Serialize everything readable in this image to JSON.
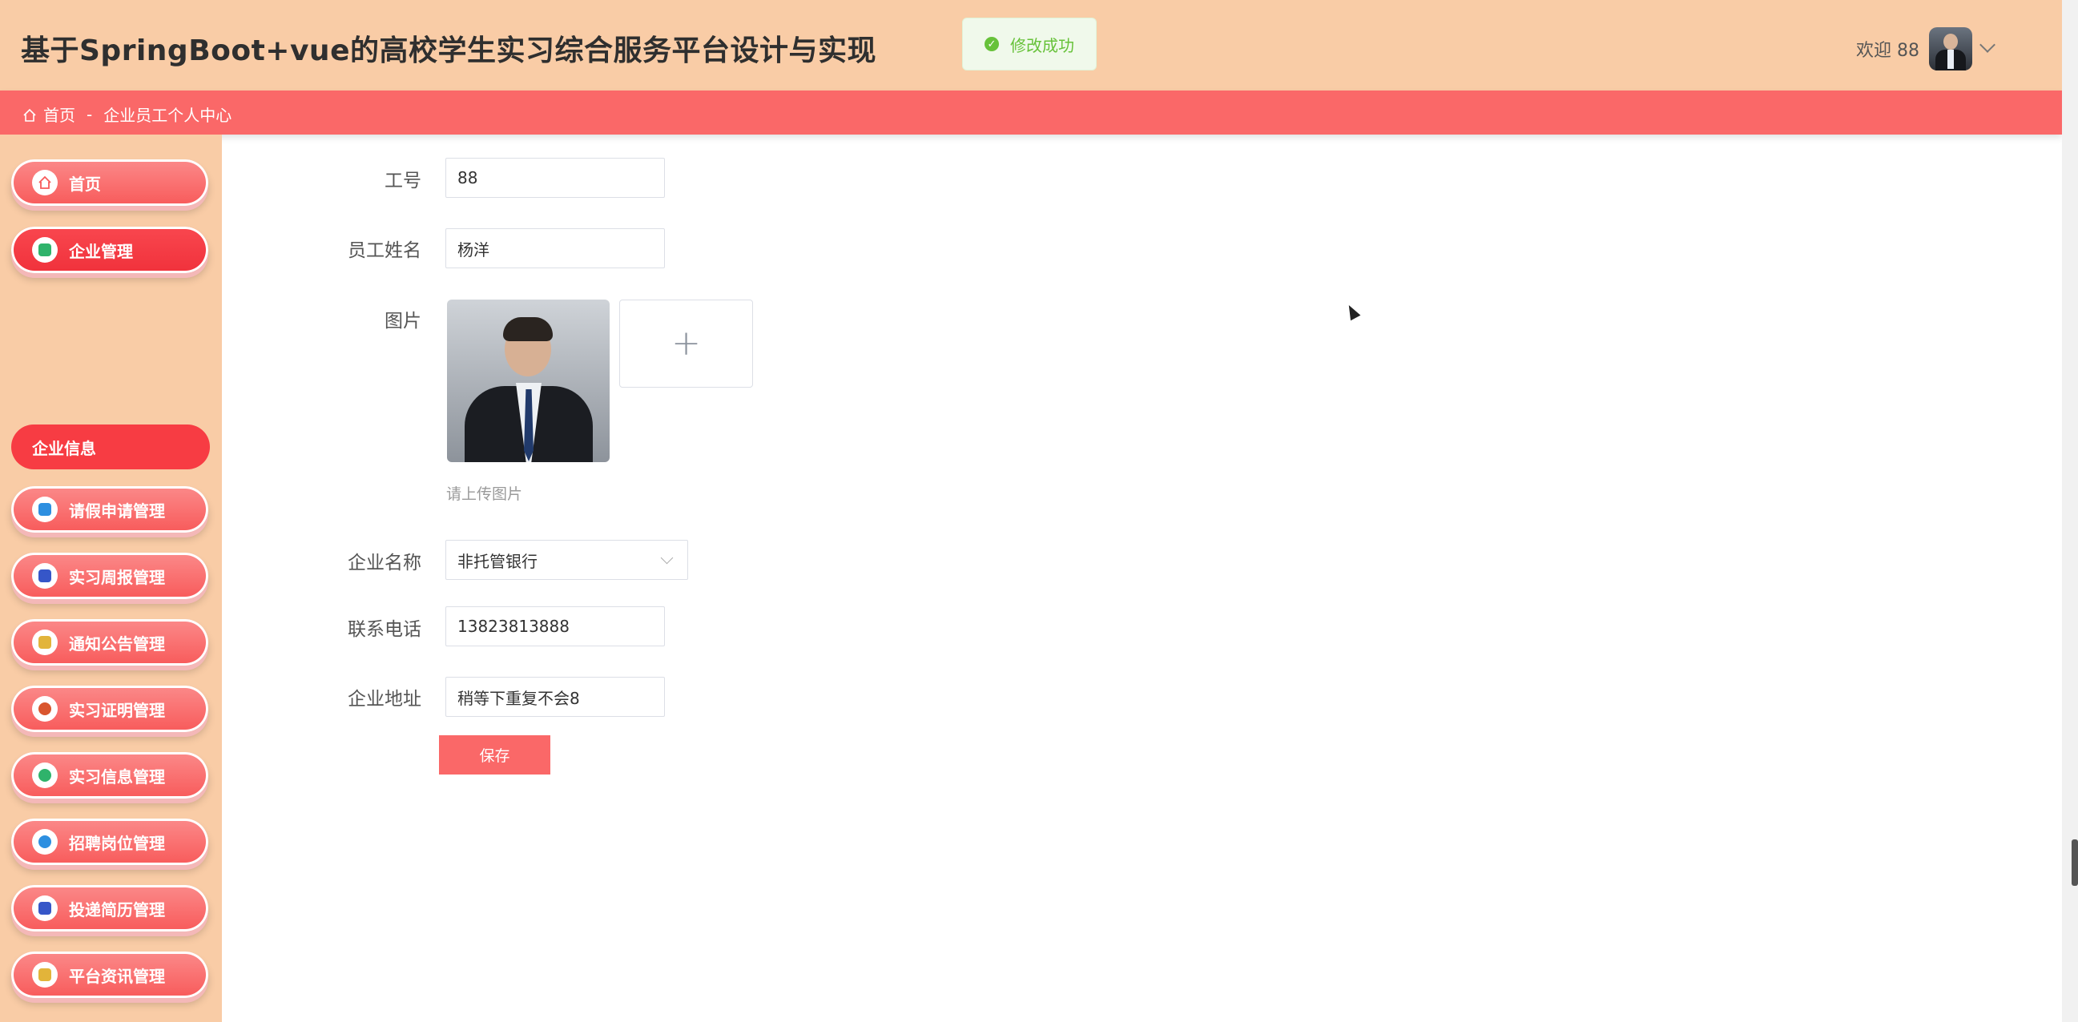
{
  "header": {
    "title": "基于SpringBoot+vue的高校学生实习综合服务平台设计与实现",
    "welcome": "欢迎 88"
  },
  "toast": {
    "message": "修改成功"
  },
  "breadcrumb": {
    "home": "首页",
    "separator": "-",
    "current": "企业员工个人中心"
  },
  "sidebar": {
    "items": [
      {
        "label": "首页",
        "icon": "home-icon"
      },
      {
        "label": "企业管理",
        "icon": "company-icon"
      },
      {
        "label": "请假申请管理",
        "icon": "leave-icon"
      },
      {
        "label": "实习周报管理",
        "icon": "report-icon"
      },
      {
        "label": "通知公告管理",
        "icon": "notice-icon"
      },
      {
        "label": "实习证明管理",
        "icon": "certificate-icon"
      },
      {
        "label": "实习信息管理",
        "icon": "info-icon"
      },
      {
        "label": "招聘岗位管理",
        "icon": "job-icon"
      },
      {
        "label": "投递简历管理",
        "icon": "resume-icon"
      },
      {
        "label": "平台资讯管理",
        "icon": "news-icon"
      }
    ],
    "sub_item": "企业信息"
  },
  "form": {
    "employee_id_label": "工号",
    "employee_id_value": "88",
    "name_label": "员工姓名",
    "name_value": "杨洋",
    "photo_label": "图片",
    "photo_hint": "请上传图片",
    "company_label": "企业名称",
    "company_value": "非托管银行",
    "phone_label": "联系电话",
    "phone_value": "13823813888",
    "address_label": "企业地址",
    "address_value": "稍等下重复不会8",
    "save_label": "保存"
  },
  "colors": {
    "header_bg": "#f9cca6",
    "accent": "#fa6868",
    "success": "#67c23a"
  }
}
